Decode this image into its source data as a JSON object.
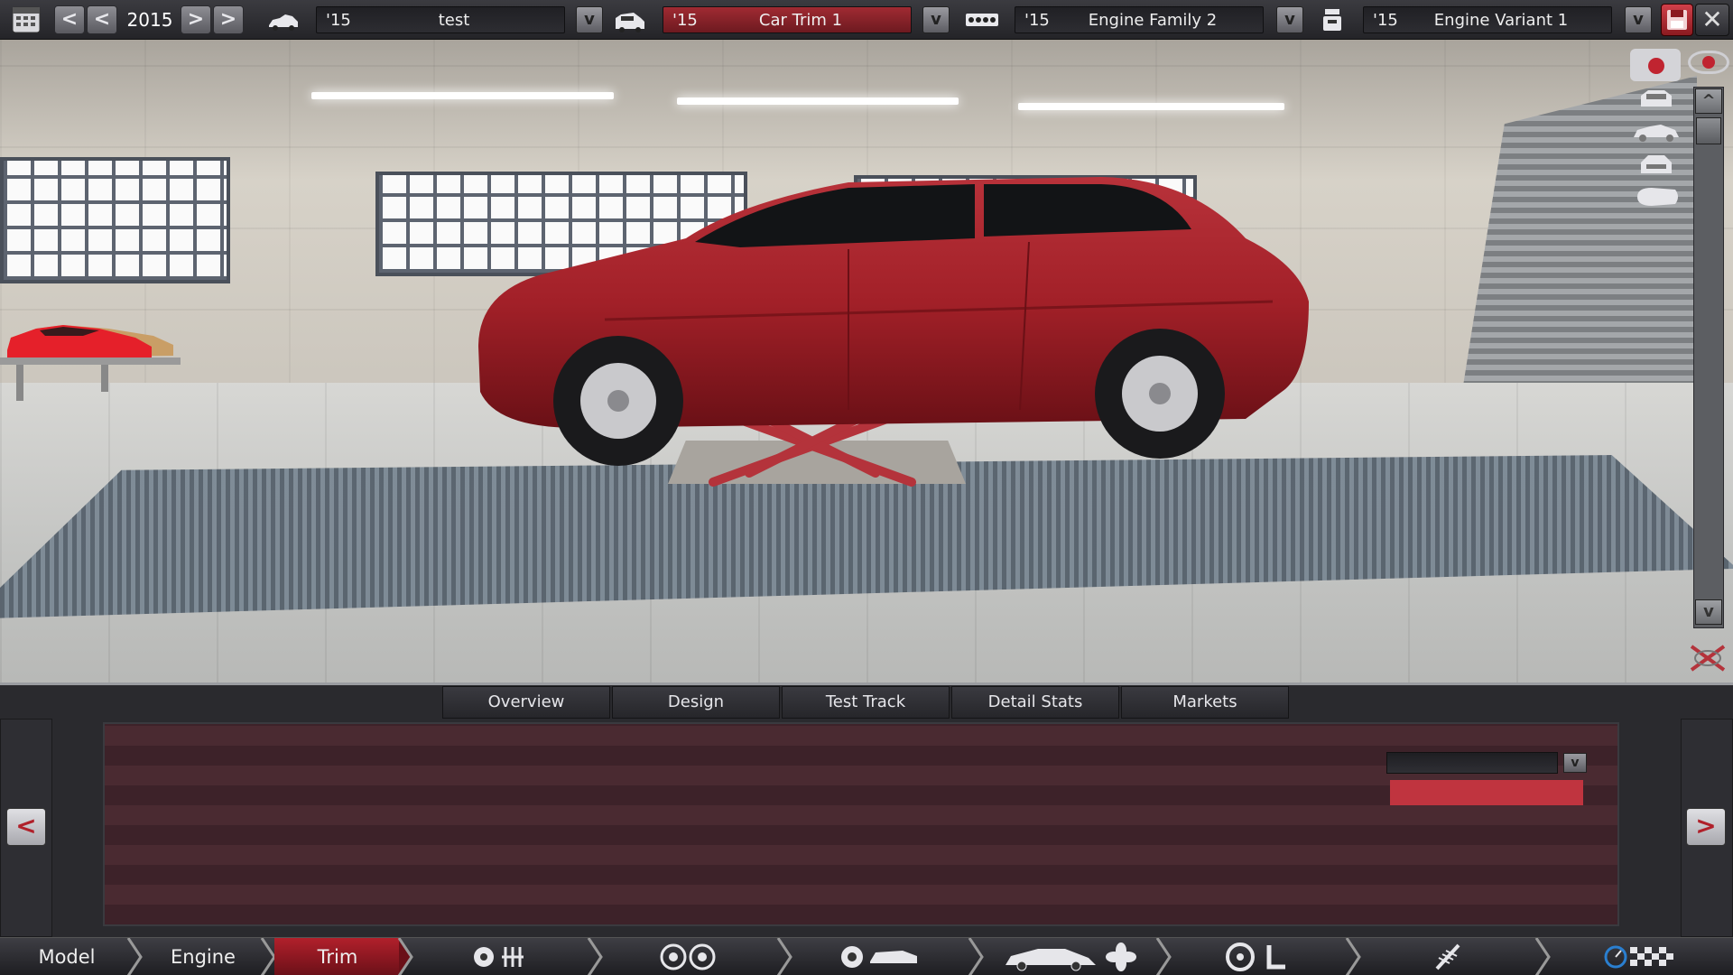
{
  "topbar": {
    "year": "2015",
    "prev_fast": "<",
    "prev": "<",
    "next": ">",
    "next_fast": ">",
    "dropdown_glyph": "v",
    "close_glyph": "✕",
    "model": {
      "year": "'15",
      "name": "test"
    },
    "trim": {
      "year": "'15",
      "name": "Car Trim 1"
    },
    "engine_family": {
      "year": "'15",
      "name": "Engine Family 2"
    },
    "engine_variant": {
      "year": "'15",
      "name": "Engine Variant 1"
    }
  },
  "viewport": {
    "scroll_up": "^",
    "scroll_down": "v"
  },
  "tabs": [
    "Overview",
    "Design",
    "Test Track",
    "Detail Stats",
    "Markets"
  ],
  "panel": {
    "nav_prev": "<",
    "nav_next": ">",
    "dropdown_glyph": "v"
  },
  "workflow": {
    "steps": [
      "Model",
      "Engine",
      "Trim"
    ],
    "active": "Trim"
  },
  "colors": {
    "accent_red": "#b1202b",
    "car_red": "#a8222a",
    "panel_bg": "#2a2a2e"
  },
  "icons": [
    "calendar-icon",
    "car-model-icon",
    "car-trim-icon",
    "engine-family-icon",
    "engine-variant-icon",
    "save-icon",
    "close-icon",
    "camera-icon",
    "eye-icon",
    "rotate-icon"
  ]
}
